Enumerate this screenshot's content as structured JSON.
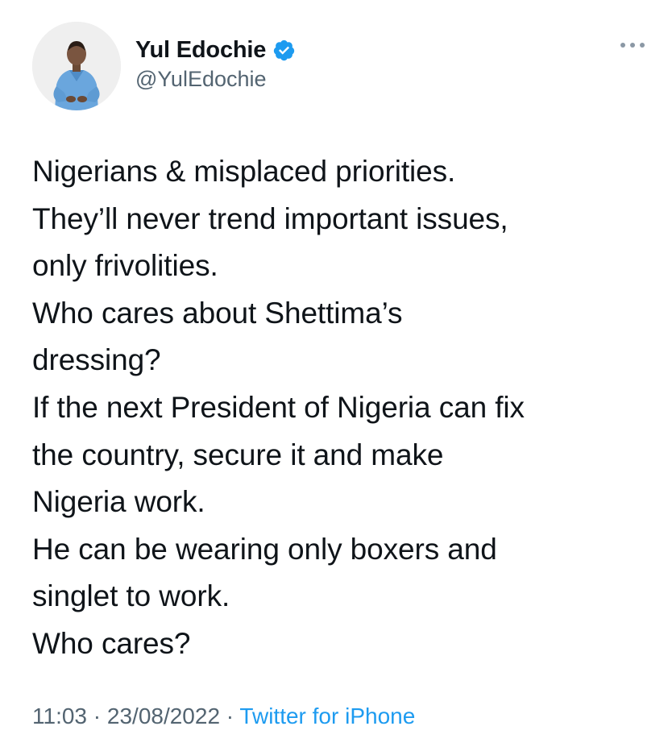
{
  "author": {
    "display_name": "Yul Edochie",
    "handle": "@YulEdochie",
    "verified": true,
    "avatar_icon": "profile-photo"
  },
  "tweet": {
    "lines": [
      "Nigerians & misplaced priorities.",
      "They’ll never trend important issues,",
      "only frivolities.",
      "Who cares about Shettima’s",
      "dressing?",
      "If the next President of Nigeria can fix",
      "the country, secure it and make",
      "Nigeria work.",
      "He can be wearing only boxers and",
      "singlet to work.",
      "Who cares?"
    ]
  },
  "meta": {
    "time": "11:03",
    "separator": " · ",
    "date": "23/08/2022",
    "source": "Twitter for iPhone"
  },
  "colors": {
    "text": "#0f1419",
    "secondary": "#536471",
    "accent": "#1d9bf0"
  },
  "icons": {
    "more": "more-horizontal-icon",
    "verified": "verified-badge-icon"
  }
}
